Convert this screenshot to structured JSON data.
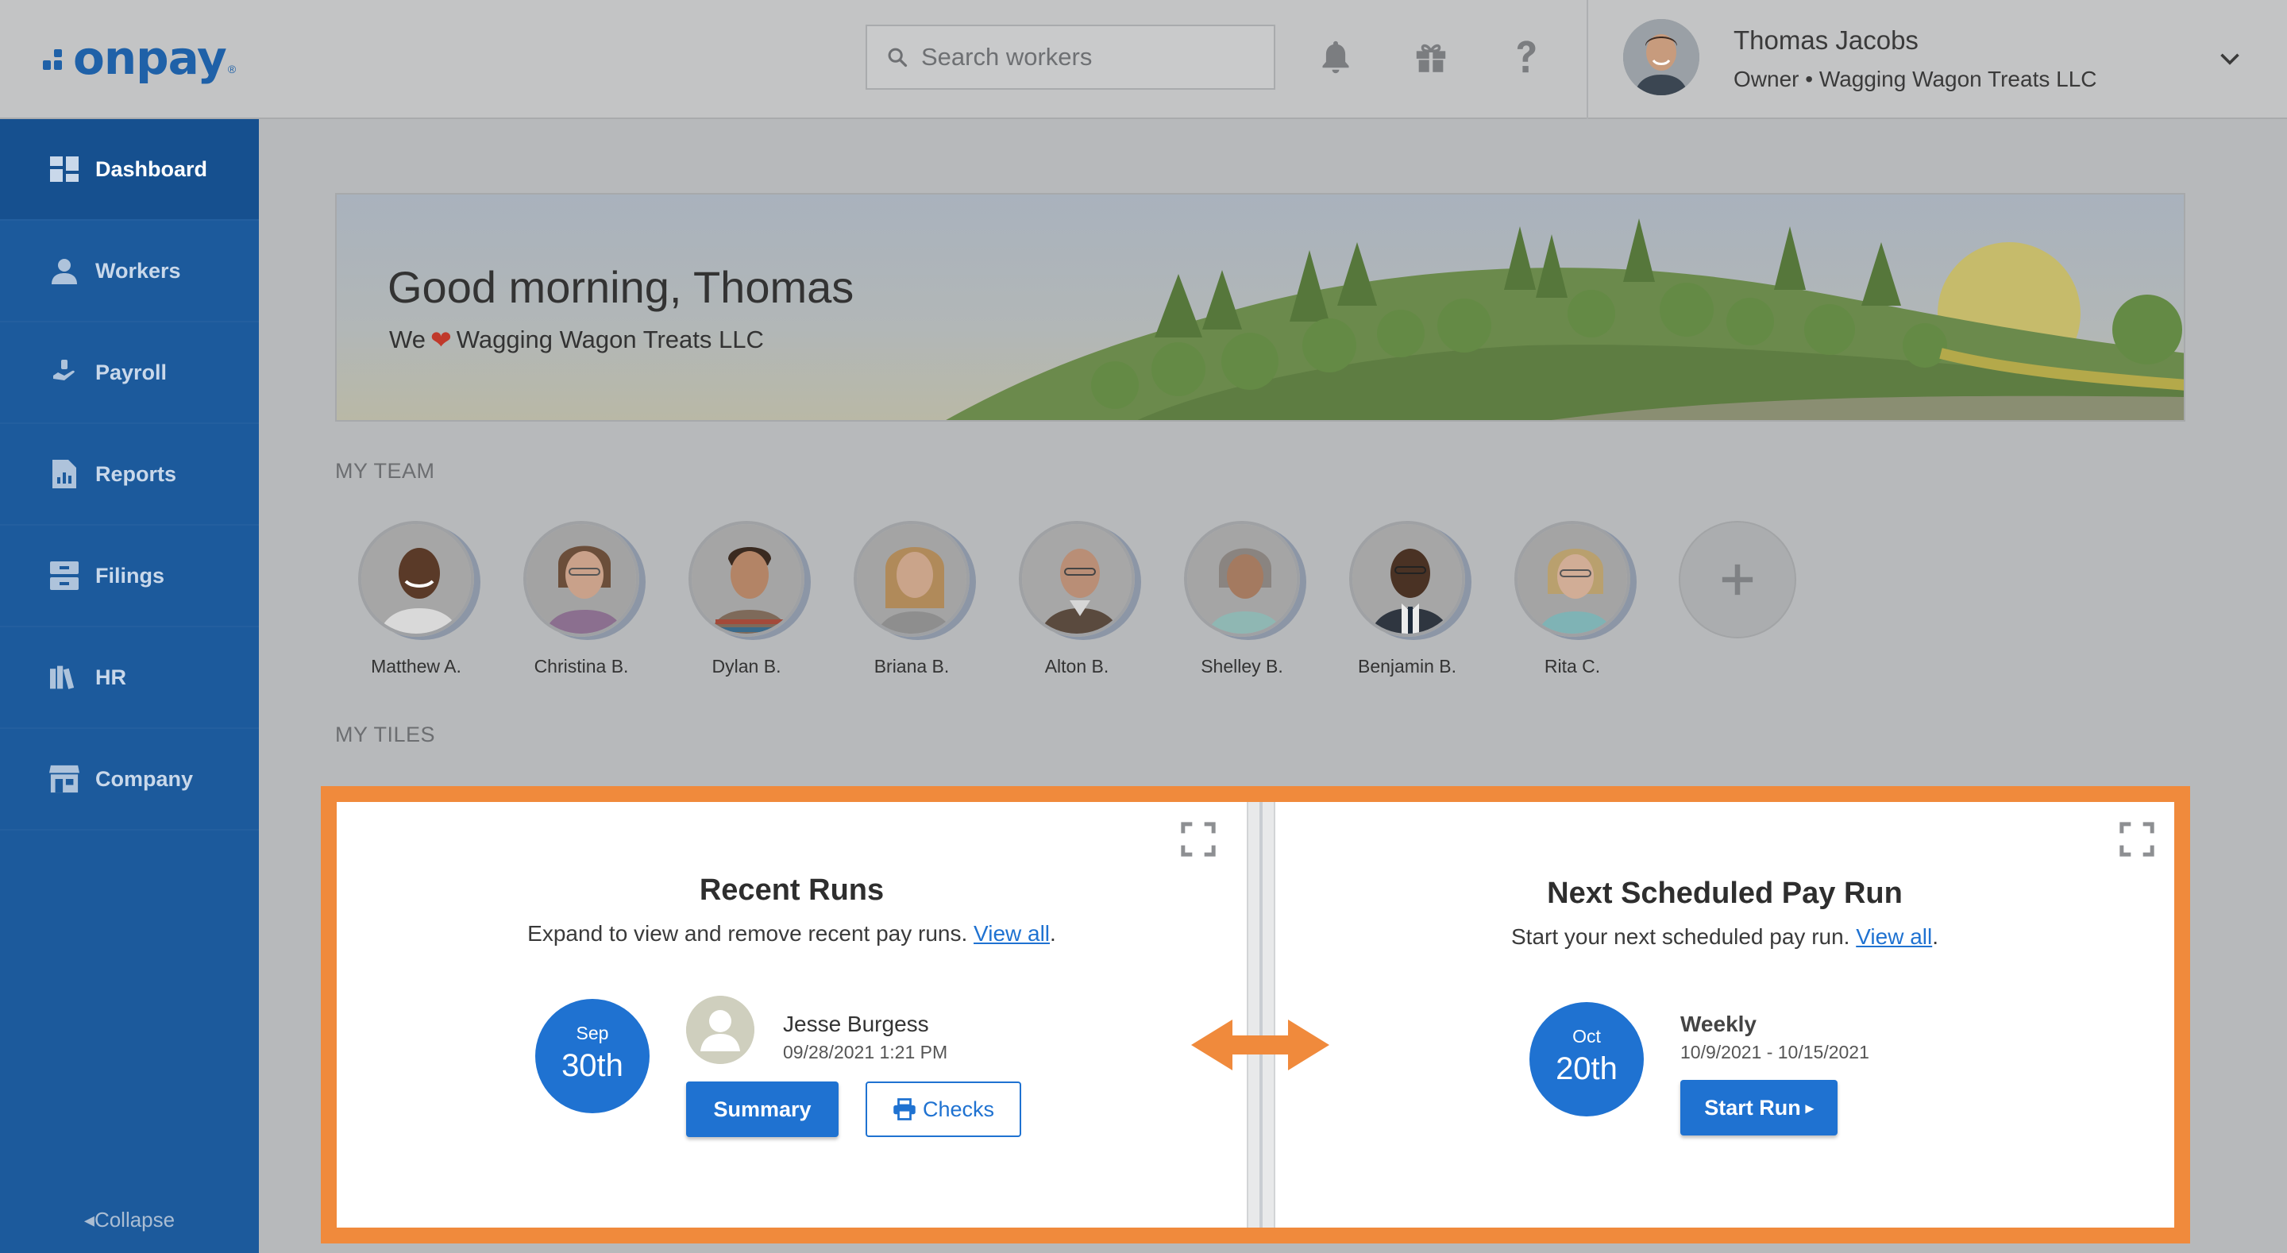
{
  "header": {
    "logo_text": "onpay",
    "logo_mark": "®",
    "search_placeholder": "Search workers",
    "user": {
      "name": "Thomas Jacobs",
      "subtitle": "Owner • Wagging Wagon Treats LLC"
    },
    "icons": [
      "bell-icon",
      "gift-icon",
      "help-icon",
      "chevron-down-icon"
    ]
  },
  "sidebar": {
    "items": [
      {
        "label": "Dashboard",
        "icon": "dashboard-icon",
        "active": true
      },
      {
        "label": "Workers",
        "icon": "workers-icon",
        "active": false
      },
      {
        "label": "Payroll",
        "icon": "payroll-icon",
        "active": false
      },
      {
        "label": "Reports",
        "icon": "reports-icon",
        "active": false
      },
      {
        "label": "Filings",
        "icon": "filings-icon",
        "active": false
      },
      {
        "label": "HR",
        "icon": "hr-icon",
        "active": false
      },
      {
        "label": "Company",
        "icon": "company-icon",
        "active": false
      }
    ],
    "collapse_label": "Collapse"
  },
  "banner": {
    "greeting": "Good morning, Thomas",
    "sub_prefix": "We",
    "sub_company": "Wagging Wagon Treats LLC"
  },
  "team": {
    "section_label": "MY TEAM",
    "members": [
      {
        "name": "Matthew A."
      },
      {
        "name": "Christina B."
      },
      {
        "name": "Dylan B."
      },
      {
        "name": "Briana B."
      },
      {
        "name": "Alton B."
      },
      {
        "name": "Shelley B."
      },
      {
        "name": "Benjamin B."
      },
      {
        "name": "Rita C."
      }
    ]
  },
  "tiles": {
    "section_label": "MY TILES",
    "recent_runs": {
      "title": "Recent Runs",
      "desc": "Expand to view and remove recent pay runs.",
      "link": "View all",
      "month": "Sep",
      "day": "30th",
      "person": "Jesse Burgess",
      "datetime": "09/28/2021 1:21 PM",
      "summary_label": "Summary",
      "checks_label": "Checks"
    },
    "next_run": {
      "title": "Next Scheduled Pay Run",
      "desc": "Start your next scheduled pay run.",
      "link": "View all",
      "month": "Oct",
      "day": "20th",
      "frequency": "Weekly",
      "period": "10/9/2021 - 10/15/2021",
      "start_label": "Start Run"
    }
  },
  "colors": {
    "brand_blue": "#1f61a8",
    "sidebar": "#1c5a9c",
    "accent_blue": "#1f72d1",
    "highlight_orange": "#f08a3c"
  }
}
